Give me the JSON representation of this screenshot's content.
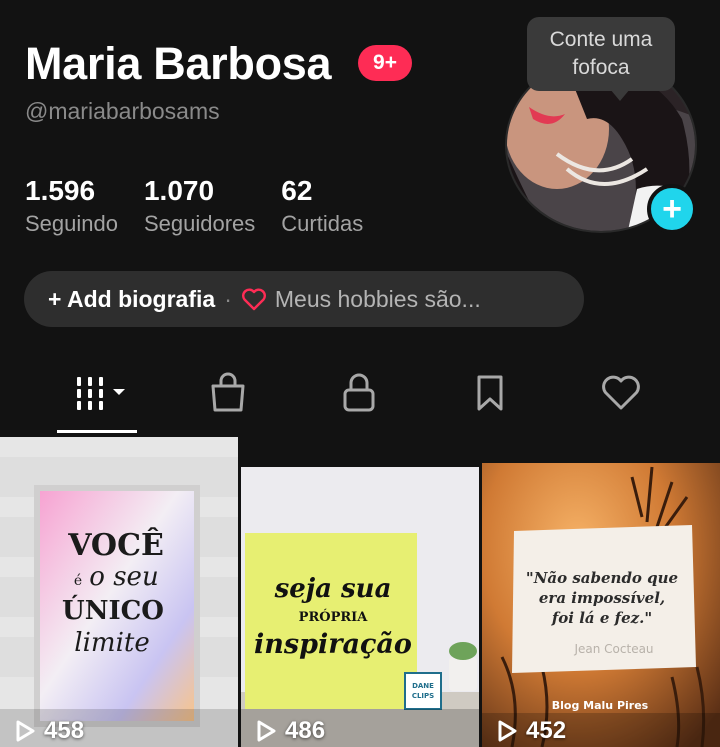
{
  "profile": {
    "name": "Maria Barbosa",
    "badge": "9+",
    "handle": "@mariabarbosams",
    "bubble_line1": "Conte uma",
    "bubble_line2": "fofoca"
  },
  "stats": [
    {
      "value": "1.596",
      "label": "Seguindo"
    },
    {
      "value": "1.070",
      "label": "Seguidores"
    },
    {
      "value": "62",
      "label": "Curtidas"
    }
  ],
  "bio": {
    "add_label": "+ Add biografia",
    "separator": "·",
    "hobby_label": "Meus hobbies são..."
  },
  "tabs": [
    {
      "icon": "grid-icon",
      "selected": true
    },
    {
      "icon": "shop-bag-icon",
      "selected": false
    },
    {
      "icon": "lock-icon",
      "selected": false
    },
    {
      "icon": "bookmark-icon",
      "selected": false
    },
    {
      "icon": "heart-icon",
      "selected": false
    }
  ],
  "videos": [
    {
      "views": "458",
      "text_lines": [
        "VOCÊ",
        "é",
        "o seu",
        "ÚNICO",
        "limite"
      ]
    },
    {
      "views": "486",
      "text_lines": [
        "seja sua",
        "PRÓPRIA",
        "inspiração"
      ],
      "logo_lines": [
        "DANE",
        "CLIPS"
      ]
    },
    {
      "views": "452",
      "quote_lines": [
        "\"Não sabendo que",
        "era impossível,",
        "foi lá e fez.\""
      ],
      "author": "Jean Cocteau",
      "credit": "Blog Malu Pires"
    }
  ],
  "colors": {
    "background": "#121212",
    "badge": "#fe2c55",
    "add_button": "#20d5ec",
    "bio_heart": "#fe2c55"
  }
}
